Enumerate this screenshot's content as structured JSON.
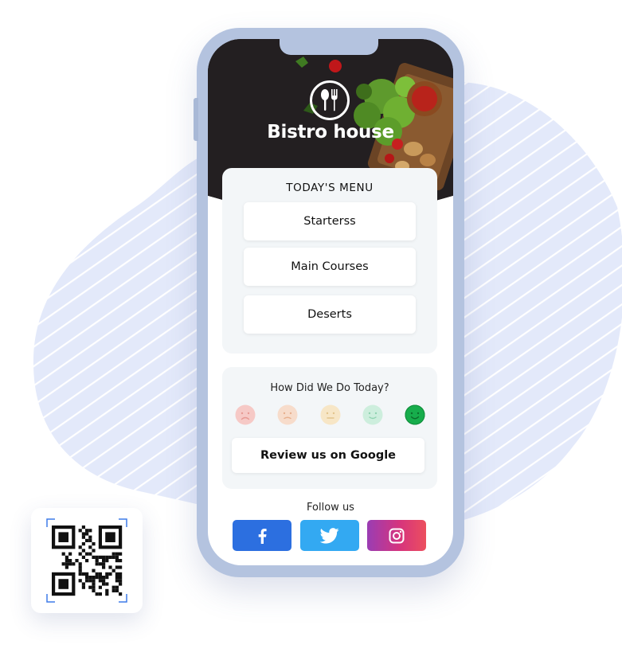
{
  "restaurant": {
    "name": "Bistro house",
    "logo_icon": "spoon-fork-icon"
  },
  "menu": {
    "title": "TODAY'S MENU",
    "items": [
      {
        "label": "Starterss"
      },
      {
        "label": "Main Courses"
      },
      {
        "label": "Deserts"
      }
    ]
  },
  "feedback": {
    "title": "How Did We Do Today?",
    "ratings": [
      {
        "icon": "very-unhappy-face-icon",
        "color": "#f6c9c6",
        "selected": false
      },
      {
        "icon": "unhappy-face-icon",
        "color": "#f7dccb",
        "selected": false
      },
      {
        "icon": "neutral-face-icon",
        "color": "#f7e6c6",
        "selected": false
      },
      {
        "icon": "happy-face-icon",
        "color": "#cdeedd",
        "selected": false
      },
      {
        "icon": "very-happy-face-icon",
        "color": "#17ad4c",
        "selected": true
      }
    ],
    "review_button": "Review us on Google"
  },
  "social": {
    "label": "Follow us",
    "links": [
      {
        "network": "Facebook",
        "icon": "facebook-icon",
        "color": "#2c6fe0"
      },
      {
        "network": "Twitter",
        "icon": "twitter-icon",
        "color": "#33a9f2"
      },
      {
        "network": "Instagram",
        "icon": "instagram-icon",
        "color": "#d6347d"
      }
    ]
  },
  "colors": {
    "phone_frame": "#b4c3df",
    "card_bg": "#f3f6f8",
    "blob": "#e3e9fa"
  }
}
